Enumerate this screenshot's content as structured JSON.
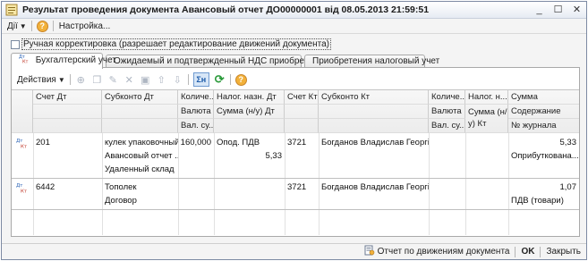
{
  "window": {
    "title": "Результат проведения документа Авансовый отчет ДО00000001 від 08.05.2013 21:59:51"
  },
  "menu": {
    "actions_label": "Дії",
    "settings_label": "Настройка..."
  },
  "manual_correction": {
    "label": "Ручная корректировка (разрешает редактирование движений документа)",
    "checked": false
  },
  "tabs": [
    {
      "label": "Бухгалтерский учет",
      "active": true
    },
    {
      "label": "Ожидаемый и подтвержденный НДС приобретений",
      "active": false
    },
    {
      "label": "Приобретения налоговый учет",
      "active": false
    }
  ],
  "toolbar": {
    "actions_label": "Действия"
  },
  "table": {
    "headers": {
      "acct_dt": "Счет Дт",
      "subkonto_dt": "Субконто Дт",
      "qty_dt": "Количе...",
      "tax_dt": "Налог. назн. Дт",
      "currency_dt": "Валюта ...",
      "sum_nu_dt": "Сумма (н/у) Дт",
      "val_sum_dt": "Вал. су...",
      "acct_kt": "Счет Кт",
      "subkonto_kt": "Субконто Кт",
      "qty_kt": "Количе...",
      "tax_kt": "Налог. н...",
      "currency_kt": "Валюта ...",
      "sum_nu_kt": "Сумма (н/у) Кт",
      "val_sum_kt": "Вал. су...",
      "sum": "Сумма",
      "content": "Содержание",
      "journal": "№ журнала"
    },
    "rows": [
      {
        "acct_dt": "201",
        "subkonto_dt": [
          "кулек упаковочный",
          "Авансовый отчет ...",
          "Удаленный склад"
        ],
        "qty_dt": "160,000",
        "tax_dt": "Опод. ПДВ",
        "sum_nu_dt": "5,33",
        "acct_kt": "3721",
        "subkonto_kt": "Богданов Владислав Георгі...",
        "sum": "5,33",
        "content": "Оприбуткована..."
      },
      {
        "acct_dt": "6442",
        "subkonto_dt": [
          "Тополек",
          "Договор"
        ],
        "qty_dt": "",
        "tax_dt": "",
        "sum_nu_dt": "",
        "acct_kt": "3721",
        "subkonto_kt": "Богданов Владислав Георгі...",
        "sum": "1,07",
        "content": "ПДВ (товари)"
      }
    ]
  },
  "status": {
    "report_label": "Отчет по движениям документа",
    "ok_label": "OK",
    "close_label": "Закрыть"
  },
  "colors": {
    "title_gradient_end": "#e6ebf3",
    "accent_sum_button": "#1c5aa8",
    "help_icon": "#f2b13a"
  }
}
